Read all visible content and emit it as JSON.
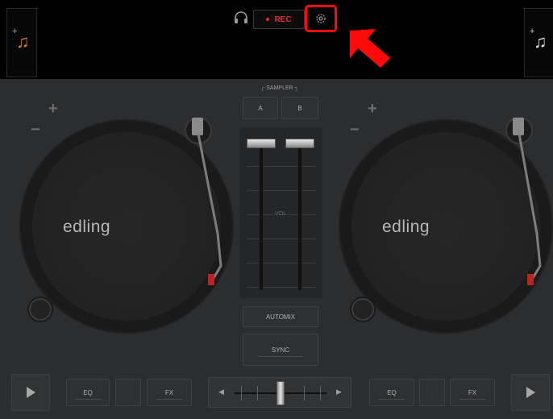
{
  "topbar": {
    "rec_label": "REC",
    "left_track_icon": "music-note-add-icon",
    "right_track_icon": "music-note-add-icon",
    "headphones_icon": "headphones-icon",
    "settings_icon": "gear-icon",
    "highlight_color": "#ff0a0a"
  },
  "decks": {
    "left": {
      "brand": "edling",
      "plus": "+",
      "minus": "−"
    },
    "right": {
      "brand": "edling",
      "plus": "+",
      "minus": "−"
    }
  },
  "sampler": {
    "label": "SAMPLER",
    "a_label": "A",
    "b_label": "B"
  },
  "mixer": {
    "vol_label": "VOL"
  },
  "buttons": {
    "automix_label": "AUTOMIX",
    "sync_label": "SYNC"
  },
  "bottom": {
    "left": {
      "eq_label": "EQ",
      "fx_label": "FX"
    },
    "right": {
      "eq_label": "EQ",
      "fx_label": "FX"
    }
  },
  "colors": {
    "accent_orange": "#d07a2c",
    "rec_red": "#e3302f",
    "background": "#2c2d2f"
  }
}
